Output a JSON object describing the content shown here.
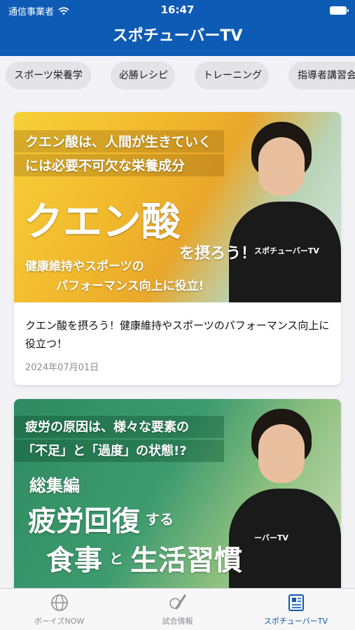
{
  "status_bar": {
    "carrier": "通信事業者",
    "time": "16:47"
  },
  "nav": {
    "title": "スポチューバーTV"
  },
  "categories": [
    {
      "label": "スポーツ栄養学"
    },
    {
      "label": "必勝レシピ"
    },
    {
      "label": "トレーニング"
    },
    {
      "label": "指導者講習会"
    }
  ],
  "articles": [
    {
      "thumbnail": {
        "lines": [
          "クエン酸は、人間が生きていく",
          "には必要不可欠な栄養成分",
          "クエン酸",
          "を摂ろう！",
          "健康維持やスポーツの",
          "パフォーマンス向上に役立!"
        ],
        "shirt_text": "スポチューバーTV"
      },
      "title": "クエン酸を摂ろう！健康維持やスポーツのパフォーマンス向上に役立つ！",
      "date": "2024年07月01日"
    },
    {
      "thumbnail": {
        "lines": [
          "疲労の原因は、様々な要素の",
          "「不足」と「過度」の状態!?",
          "総集編",
          "疲労回復",
          "する",
          "食事",
          "と",
          "生活習慣"
        ],
        "shirt_text": "ーバーTV"
      }
    }
  ],
  "tabs": [
    {
      "label": "ボーイズNOW",
      "icon": "globe-icon"
    },
    {
      "label": "試合情報",
      "icon": "baseball-bat-icon"
    },
    {
      "label": "スポチューバーTV",
      "icon": "news-icon"
    }
  ],
  "colors": {
    "primary": "#0d5bb5",
    "background": "#f2f2f7"
  }
}
